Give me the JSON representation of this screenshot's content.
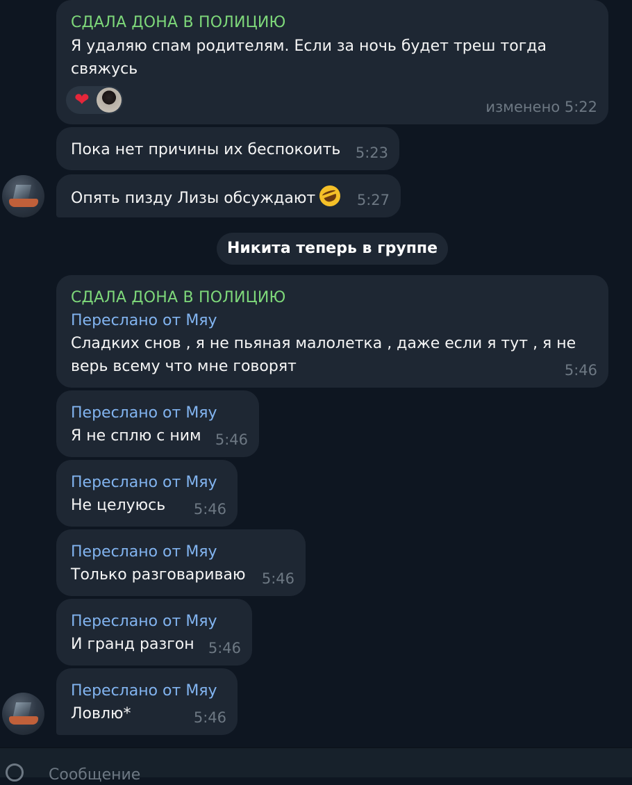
{
  "messages": [
    {
      "sender": "СДАЛА ДОНА В ПОЛИЦИЮ",
      "lines": [
        "Я удаляю спам родителям. Если за ночь будет треш тогда",
        "свяжусь"
      ],
      "time": "изменено 5:22",
      "reactions": [
        {
          "emoji": "❤",
          "icon": "heart-icon"
        }
      ]
    },
    {
      "lines": [
        "Пока нет причины их беспокоить"
      ],
      "time": "5:23"
    },
    {
      "lines": [
        "Опять пизду Лизы обсуждают"
      ],
      "emoji_icon": "rolling-on-floor-laughing-emoji",
      "time": "5:27"
    },
    {
      "sender": "СДАЛА ДОНА В ПОЛИЦИЮ",
      "forwarded": "Переслано от Мяу",
      "lines": [
        "Сладких снов , я не пьяная малолетка , даже если я тут , я не",
        "верь всему что мне говорят"
      ],
      "time": "5:46"
    },
    {
      "forwarded": "Переслано от Мяу",
      "lines": [
        "Я не сплю с ним"
      ],
      "time": "5:46"
    },
    {
      "forwarded": "Переслано от Мяу",
      "lines": [
        "Не целуюсь"
      ],
      "time": "5:46"
    },
    {
      "forwarded": "Переслано от Мяу",
      "lines": [
        "Только разговариваю"
      ],
      "time": "5:46"
    },
    {
      "forwarded": "Переслано от Мяу",
      "lines": [
        "И гранд разгон"
      ],
      "time": "5:46"
    },
    {
      "forwarded": "Переслано от Мяу",
      "lines": [
        "Ловлю*"
      ],
      "time": "5:46"
    }
  ],
  "service_message": "Никита теперь в группе",
  "composer": {
    "placeholder": "Сообщение"
  },
  "colors": {
    "background": "#0e1621",
    "bubble": "#1e2733",
    "sender_name": "#7ed87a",
    "forwarded_label": "#82b4f0",
    "time": "#6d7883"
  }
}
